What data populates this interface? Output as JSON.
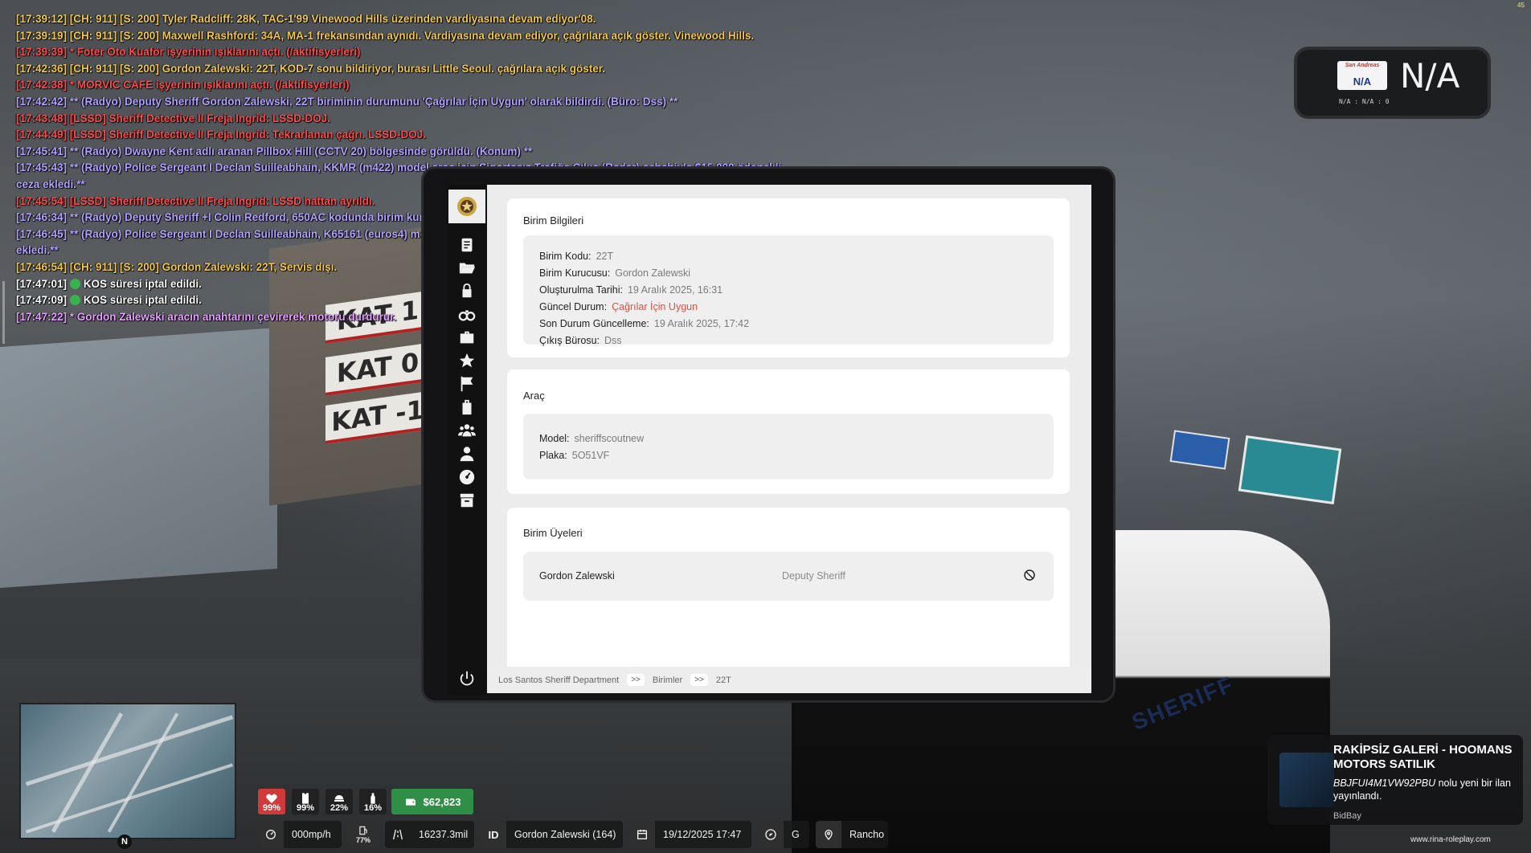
{
  "chat": [
    {
      "color": "yellow",
      "text": "[17:39:12] [CH: 911] [S: 200] Tyler Radcliff: 28K, TAC-1'99 Vinewood Hills üzerinden vardiyasına devam ediyor'08."
    },
    {
      "color": "yellow",
      "text": "[17:39:19] [CH: 911] [S: 200] Maxwell Rashford: 34A, MA-1 frekansından aynıdı. Vardiyasına devam ediyor, çağrılara açık göster. Vinewood Hills."
    },
    {
      "color": "red",
      "text": "[17:39:39] * Foter Oto Kuaför işyerinin ışıklarını açtı. (/aktifisyerleri)"
    },
    {
      "color": "yellow",
      "text": "[17:42:36] [CH: 911] [S: 200] Gordon Zalewski: 22T, KOD-7 sonu bildiriyor, burası Little Seoul. çağrılara açık göster."
    },
    {
      "color": "red",
      "text": "[17:42:38] * MORVIC CAFE işyerinin ışıklarını açtı. (/aktifisyerleri)"
    },
    {
      "color": "purple",
      "text": "[17:42:42] ** (Radyo) Deputy Sheriff Gordon Zalewski, 22T biriminin durumunu 'Çağrılar İçin Uygun' olarak bildirdi. (Büro: Dss) **"
    },
    {
      "color": "red",
      "text": "[17:43:48] [LSSD] Sheriff Detective II Freja Ingrid: LSSD-DOJ."
    },
    {
      "color": "red",
      "text": "[17:44:49] [LSSD] Sheriff Detective II Freja Ingrid: Tekrarlanan çağrı. LSSD-DOJ."
    },
    {
      "color": "purple",
      "text": "[17:45:41] ** (Radyo) Dwayne Kent adlı aranan Pillbox Hill (CCTV 20) bölgesinde görüldü. (Konum) **"
    },
    {
      "color": "purple",
      "text": "[17:45:43] ** (Radyo) Police Sergeant I Declan Suilleabhain, KKMR (m422) model araç için Sigortasız Trafiğe Çıkış (Radar) sebebiyle $15,000 ödenekli ceza ekledi.**"
    },
    {
      "color": "red",
      "text": "[17:45:54] [LSSD] Sheriff Detective II Freja Ingrid: LSSD hattan ayrıldı."
    },
    {
      "color": "purple",
      "text": "[17:46:34] ** (Radyo) Deputy Sheriff +I Colin Redford, 650AC kodunda birim kurdu. (DSS) **"
    },
    {
      "color": "purple",
      "text": "[17:46:45] ** (Radyo) Police Sergeant I Declan Suilleabhain, K65161 (euros4) model araç için Hız Sınırı İhlali (Radar) sebebiyle $15,000 ödenekli ceza ekledi.**"
    },
    {
      "color": "yellow",
      "text": "[17:46:54] [CH: 911] [S: 200] Gordon Zalewski: 22T, Servis dışı."
    },
    {
      "color": "white",
      "dot": true,
      "text": "[17:47:01]  KOS süresi iptal edildi."
    },
    {
      "color": "white",
      "dot": true,
      "text": "[17:47:09]  KOS süresi iptal edildi."
    },
    {
      "color": "pink",
      "text": "[17:47:22] * Gordon Zalewski aracın anahtarını çevirerek motoru durdurur."
    }
  ],
  "dashcam": {
    "plate_state": "San Andreas",
    "plate_text": "N/A",
    "display": "N/A",
    "sub": "N/A : N/A : 0"
  },
  "scene": {
    "kat1": "KAT 1",
    "kat0": "KAT 0",
    "katm1": "KAT -1",
    "car_badge": "SHERIFF"
  },
  "tablet": {
    "unit_info": {
      "title": "Birim Bilgileri",
      "fields": [
        {
          "label": "Birim Kodu:",
          "value": "22T"
        },
        {
          "label": "Birim Kurucusu:",
          "value": "Gordon Zalewski"
        },
        {
          "label": "Oluşturulma Tarihi:",
          "value": "19 Aralık 2025, 16:31"
        },
        {
          "label": "Güncel Durum:",
          "value": "Çağrılar İçin Uygun"
        },
        {
          "label": "Son Durum Güncelleme:",
          "value": "19 Aralık 2025, 17:42"
        },
        {
          "label": "Çıkış Bürosu:",
          "value": "Dss"
        }
      ]
    },
    "vehicle": {
      "title": "Araç",
      "fields": [
        {
          "label": "Model:",
          "value": "sheriffscoutnew"
        },
        {
          "label": "Plaka:",
          "value": "5O51VF"
        }
      ]
    },
    "members": {
      "title": "Birim Üyeleri",
      "rows": [
        {
          "name": "Gordon Zalewski",
          "rank": "Deputy Sheriff"
        }
      ]
    },
    "breadcrumb": {
      "dept": "Los Santos Sheriff Department",
      "sep": ">>",
      "section": "Birimler",
      "current": "22T"
    },
    "status_color": "#e74c3c"
  },
  "hud": {
    "health": "99%",
    "armor": "99%",
    "hunger": "22%",
    "thirst": "16%",
    "money": "$62,823",
    "speed": "000mp/h",
    "fuel": "77%",
    "odometer": "16237.3mil",
    "id_label": "ID",
    "player": "Gordon Zalewski (164)",
    "datetime": "19/12/2025 17:47",
    "heading": "G",
    "zone": "Rancho"
  },
  "minimap": {
    "north": "N"
  },
  "notification": {
    "title": "RAKİPSİZ GALERİ - HOOMANS MOTORS SATILIK",
    "plate": "BBJFUI4M1VW92PBU",
    "body": " nolu yeni bir ilan yayınlandı.",
    "source": "BidBay"
  },
  "watermark": "www.rina-roleplay.com",
  "fps": "45"
}
